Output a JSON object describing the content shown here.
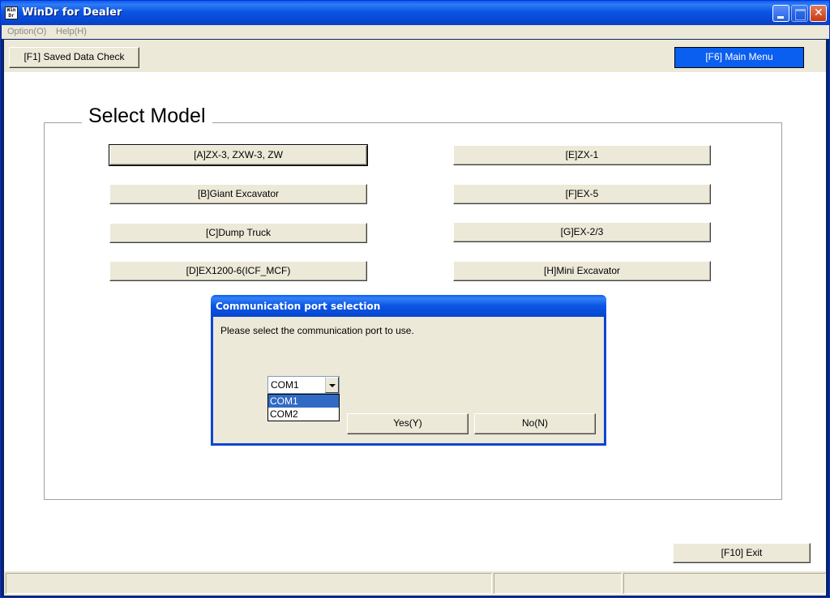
{
  "window": {
    "title": "WinDr for Dealer",
    "icon_text": "Win Dr"
  },
  "menu": {
    "items": [
      "Option(O)",
      "Help(H)"
    ]
  },
  "toolbar": {
    "saved_data_label": "[F1] Saved Data Check",
    "main_menu_label": "[F6] Main Menu"
  },
  "select_model": {
    "title": "Select Model",
    "left_buttons": [
      "[A]ZX-3, ZXW-3, ZW",
      "[B]Giant Excavator",
      "[C]Dump Truck",
      "[D]EX1200-6(ICF_MCF)"
    ],
    "right_buttons": [
      "[E]ZX-1",
      "[F]EX-5",
      "[G]EX-2/3",
      "[H]Mini Excavator"
    ]
  },
  "dialog": {
    "title": "Communication port selection",
    "message": "Please select the communication port to use.",
    "combo_value": "COM1",
    "options": [
      "COM1",
      "COM2"
    ],
    "selected_option": "COM1",
    "yes_label": "Yes(Y)",
    "no_label": "No(N)"
  },
  "footer": {
    "exit_label": "[F10] Exit"
  },
  "colors": {
    "titlebar": "#0a55e4",
    "face": "#ece9d8",
    "highlight": "#316ac5"
  }
}
